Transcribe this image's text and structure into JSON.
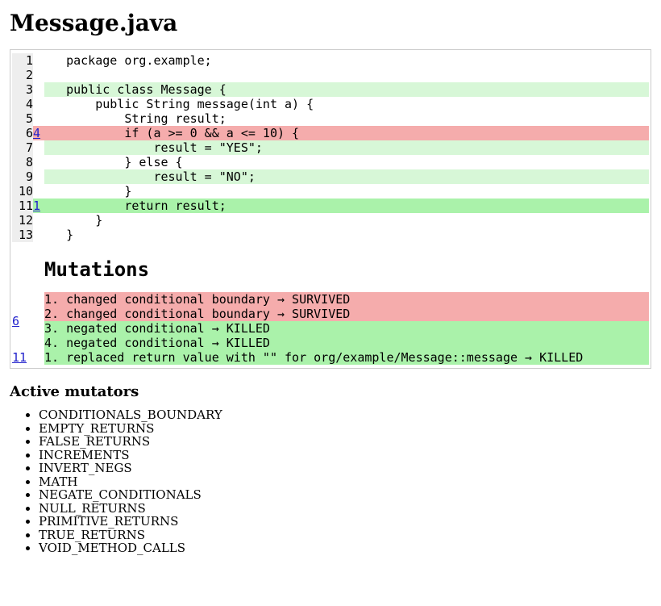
{
  "title": "Message.java",
  "code_lines": [
    {
      "n": 1,
      "cov": "",
      "covClass": "",
      "codeClass": "",
      "code": "   package org.example;"
    },
    {
      "n": 2,
      "cov": "",
      "covClass": "",
      "codeClass": "",
      "code": "   "
    },
    {
      "n": 3,
      "cov": "",
      "covClass": "",
      "codeClass": "cov-green",
      "code": "   public class Message {"
    },
    {
      "n": 4,
      "cov": "",
      "covClass": "",
      "codeClass": "",
      "code": "       public String message(int a) {"
    },
    {
      "n": 5,
      "cov": "",
      "covClass": "",
      "codeClass": "",
      "code": "           String result;"
    },
    {
      "n": 6,
      "cov": "4",
      "covClass": "cov-red",
      "codeClass": "cov-red",
      "code": "           if (a >= 0 && a <= 10) {"
    },
    {
      "n": 7,
      "cov": "",
      "covClass": "",
      "codeClass": "cov-green",
      "code": "               result = \"YES\";"
    },
    {
      "n": 8,
      "cov": "",
      "covClass": "",
      "codeClass": "",
      "code": "           } else {"
    },
    {
      "n": 9,
      "cov": "",
      "covClass": "",
      "codeClass": "cov-green",
      "code": "               result = \"NO\";"
    },
    {
      "n": 10,
      "cov": "",
      "covClass": "",
      "codeClass": "",
      "code": "           }"
    },
    {
      "n": 11,
      "cov": "1",
      "covClass": "cov-lgreen",
      "codeClass": "cov-lgreen",
      "code": "           return result;"
    },
    {
      "n": 12,
      "cov": "",
      "covClass": "",
      "codeClass": "",
      "code": "       }"
    },
    {
      "n": 13,
      "cov": "",
      "covClass": "",
      "codeClass": "",
      "code": "   }"
    }
  ],
  "mutations_heading": "Mutations",
  "mutations": [
    {
      "line": "6",
      "items": [
        {
          "status": "bg-survived",
          "text": "1. changed conditional boundary → SURVIVED"
        },
        {
          "status": "bg-survived",
          "text": "2. changed conditional boundary → SURVIVED"
        },
        {
          "status": "bg-killed",
          "text": "3. negated conditional → KILLED"
        },
        {
          "status": "bg-killed",
          "text": "4. negated conditional → KILLED"
        }
      ]
    },
    {
      "line": "11",
      "items": [
        {
          "status": "bg-killed",
          "text": "1. replaced return value with \"\" for org/example/Message::message → KILLED"
        }
      ]
    }
  ],
  "active_mutators_heading": "Active mutators",
  "active_mutators": [
    "CONDITIONALS_BOUNDARY",
    "EMPTY_RETURNS",
    "FALSE_RETURNS",
    "INCREMENTS",
    "INVERT_NEGS",
    "MATH",
    "NEGATE_CONDITIONALS",
    "NULL_RETURNS",
    "PRIMITIVE_RETURNS",
    "TRUE_RETURNS",
    "VOID_METHOD_CALLS"
  ]
}
